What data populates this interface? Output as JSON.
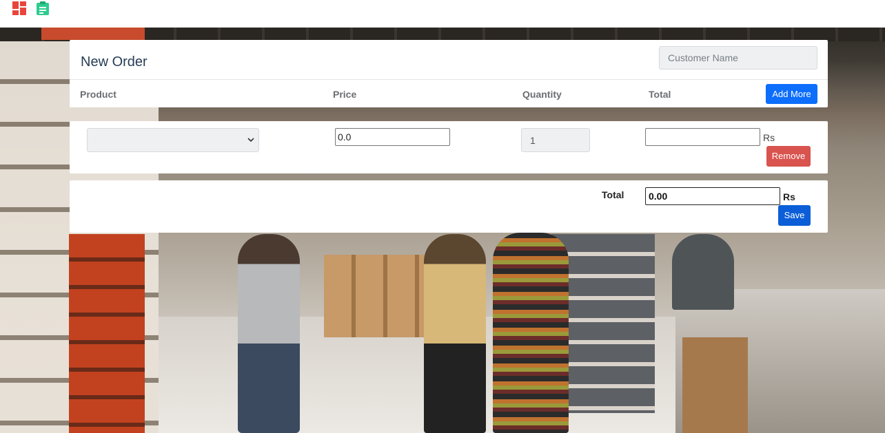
{
  "nav": {
    "icons": [
      "dashboard-icon",
      "clipboard-icon"
    ],
    "colors": {
      "dashboard": "#e8453c",
      "clipboard": "#2ecc8f"
    }
  },
  "order": {
    "title": "New Order",
    "customer_placeholder": "Customer Name",
    "columns": {
      "product": "Product",
      "price": "Price",
      "quantity": "Quantity",
      "total": "Total"
    },
    "add_more_label": "Add More"
  },
  "row": {
    "product_value": "",
    "price_value": "0.0",
    "quantity_value": "1",
    "total_value": "",
    "currency": "Rs",
    "remove_label": "Remove"
  },
  "summary": {
    "total_label": "Total",
    "total_value": "0.00",
    "currency": "Rs",
    "save_label": "Save"
  },
  "colors": {
    "primary": "#0d6efd",
    "danger": "#d9534f",
    "save": "#0b5ed7"
  }
}
